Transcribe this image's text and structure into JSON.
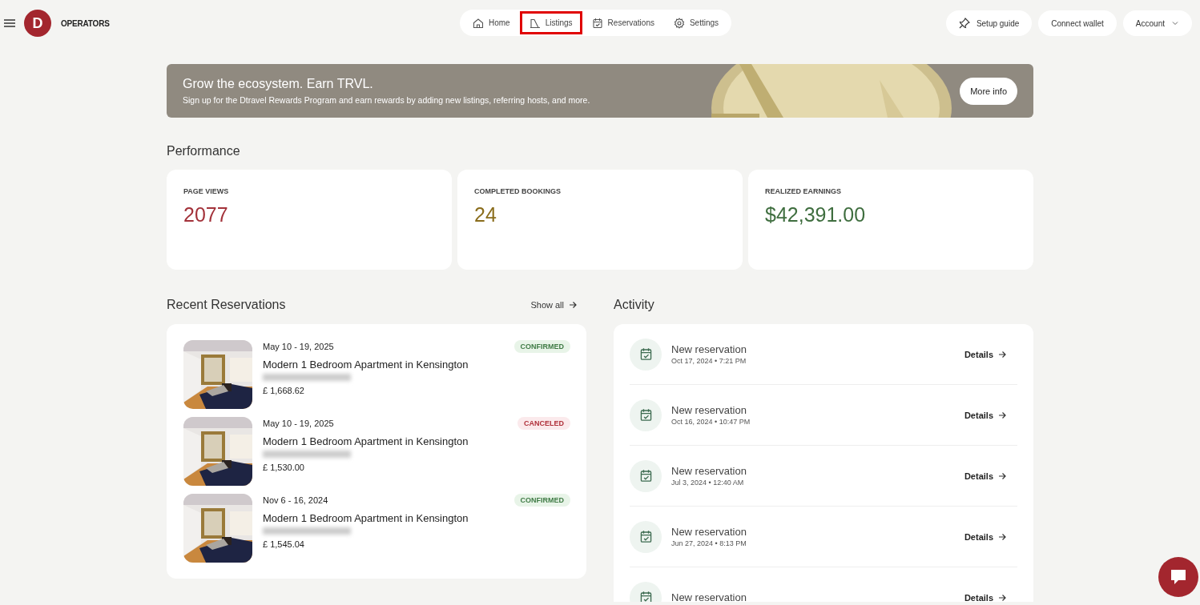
{
  "header": {
    "brand": "OPERATORS",
    "logo_letter": "D",
    "nav": [
      {
        "label": "Home",
        "kind": "home",
        "highlighted": false
      },
      {
        "label": "Listings",
        "kind": "listings",
        "highlighted": true
      },
      {
        "label": "Reservations",
        "kind": "reservations",
        "highlighted": false
      },
      {
        "label": "Settings",
        "kind": "settings",
        "highlighted": false
      }
    ],
    "setup_guide": "Setup guide",
    "connect_wallet": "Connect wallet",
    "account": "Account"
  },
  "banner": {
    "title": "Grow the ecosystem. Earn TRVL.",
    "text": "Sign up for the Dtravel Rewards Program and earn rewards by adding new listings, referring hosts, and more.",
    "button": "More info"
  },
  "performance": {
    "title": "Performance",
    "stats": [
      {
        "label": "PAGE VIEWS",
        "value": "2077",
        "color": "#a3323a"
      },
      {
        "label": "COMPLETED BOOKINGS",
        "value": "24",
        "color": "#8a6d1c"
      },
      {
        "label": "REALIZED EARNINGS",
        "value": "$42,391.00",
        "color": "#3f6e3f"
      }
    ]
  },
  "recent_reservations": {
    "title": "Recent Reservations",
    "show_all": "Show all",
    "items": [
      {
        "dates": "May 10 - 19, 2025",
        "listing": "Modern 1 Bedroom Apartment in Kensington",
        "price": "£ 1,668.62",
        "status": "CONFIRMED",
        "kind": "confirmed"
      },
      {
        "dates": "May 10 - 19, 2025",
        "listing": "Modern 1 Bedroom Apartment in Kensington",
        "price": "£ 1,530.00",
        "status": "CANCELED",
        "kind": "canceled"
      },
      {
        "dates": "Nov 6 - 16, 2024",
        "listing": "Modern 1 Bedroom Apartment in Kensington",
        "price": "£ 1,545.04",
        "status": "CONFIRMED",
        "kind": "confirmed"
      }
    ]
  },
  "activity": {
    "title": "Activity",
    "items": [
      {
        "title": "New reservation",
        "time": "Oct 17, 2024 • 7:21 PM",
        "link": "Details"
      },
      {
        "title": "New reservation",
        "time": "Oct 16, 2024 • 10:47 PM",
        "link": "Details"
      },
      {
        "title": "New reservation",
        "time": "Jul 3, 2024 • 12:40 AM",
        "link": "Details"
      },
      {
        "title": "New reservation",
        "time": "Jun 27, 2024 • 8:13 PM",
        "link": "Details"
      },
      {
        "title": "New reservation",
        "link": "Details"
      }
    ]
  }
}
